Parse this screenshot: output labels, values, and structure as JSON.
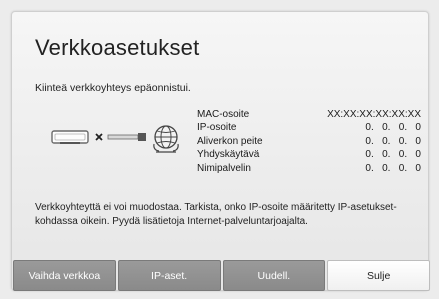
{
  "dialog": {
    "title": "Verkkoasetukset",
    "status": "Kiinteä verkkoyhteys epäonnistui.",
    "info_rows": [
      {
        "label": "MAC-osoite",
        "value": "XX:XX:XX:XX:XX:XX"
      },
      {
        "label": "IP-osoite",
        "value": "0.   0.   0.   0"
      },
      {
        "label": "Aliverkon peite",
        "value": "0.   0.   0.   0"
      },
      {
        "label": "Yhdyskäytävä",
        "value": "0.   0.   0.   0"
      },
      {
        "label": "Nimipalvelin",
        "value": "0.   0.   0.   0"
      }
    ],
    "message": "Verkkoyhteyttä ei voi muodostaa. Tarkista, onko IP-osoite määritetty IP-asetukset-kohdassa oikein. Pyydä lisätietoja Internet-palveluntarjoajalta.",
    "buttons": {
      "change_network": "Vaihda verkkoa",
      "ip_settings": "IP-aset.",
      "retry": "Uudell.",
      "close": "Sulje"
    },
    "selected_button": "close",
    "diagram_icons": [
      "tv-device-icon",
      "disconnected-x-icon",
      "cable-icon",
      "globe-icon"
    ]
  }
}
